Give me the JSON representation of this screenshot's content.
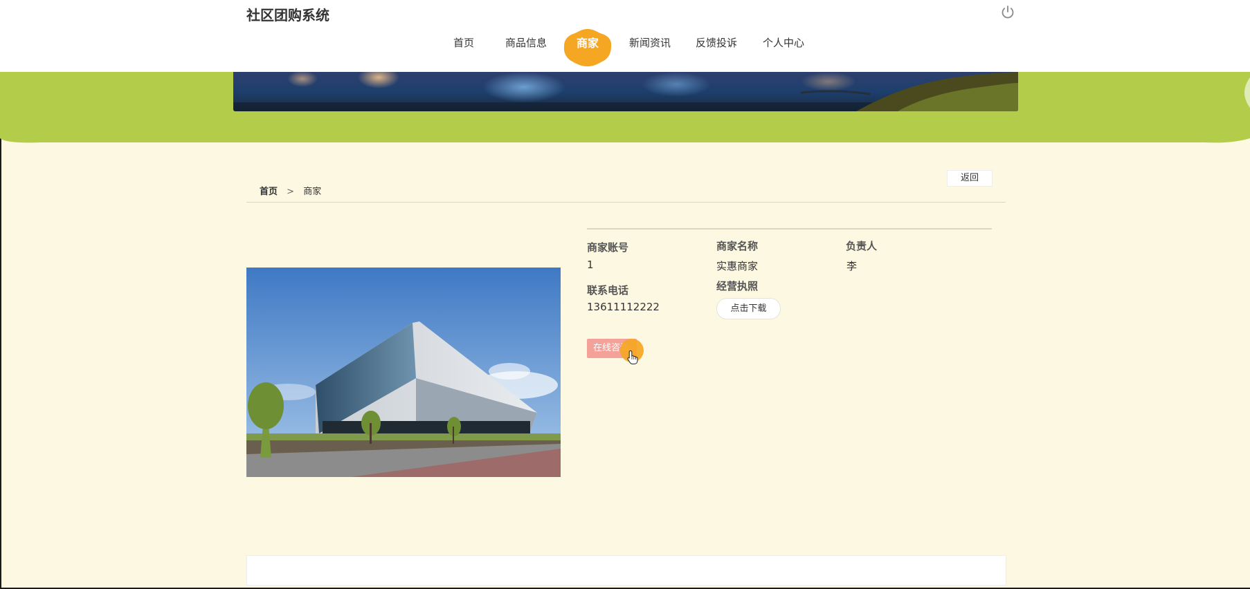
{
  "site": {
    "title": "社区团购系统"
  },
  "nav": {
    "items": [
      {
        "label": "首页",
        "active": false
      },
      {
        "label": "商品信息",
        "active": false
      },
      {
        "label": "商家",
        "active": true
      },
      {
        "label": "新闻资讯",
        "active": false
      },
      {
        "label": "反馈投诉",
        "active": false
      },
      {
        "label": "个人中心",
        "active": false
      }
    ]
  },
  "breadcrumb": {
    "home": "首页",
    "separator": ">",
    "current": "商家"
  },
  "actions": {
    "back_label": "返回",
    "download_label": "点击下载",
    "consult_label": "在线咨询"
  },
  "merchant": {
    "fields": [
      {
        "label": "商家账号",
        "value": "1"
      },
      {
        "label": "商家名称",
        "value": "实惠商家"
      },
      {
        "label": "负责人",
        "value": "李"
      },
      {
        "label": "联系电话",
        "value": "13611112222"
      },
      {
        "label": "经营执照",
        "value": ""
      }
    ]
  },
  "colors": {
    "accent": "#f5a623",
    "banner_green": "#b3cc4a",
    "page_bg": "#fdf8e2",
    "consult_button": "#f4a19a"
  },
  "icons": {
    "power": "power-icon",
    "cursor": "hand-cursor-icon"
  }
}
